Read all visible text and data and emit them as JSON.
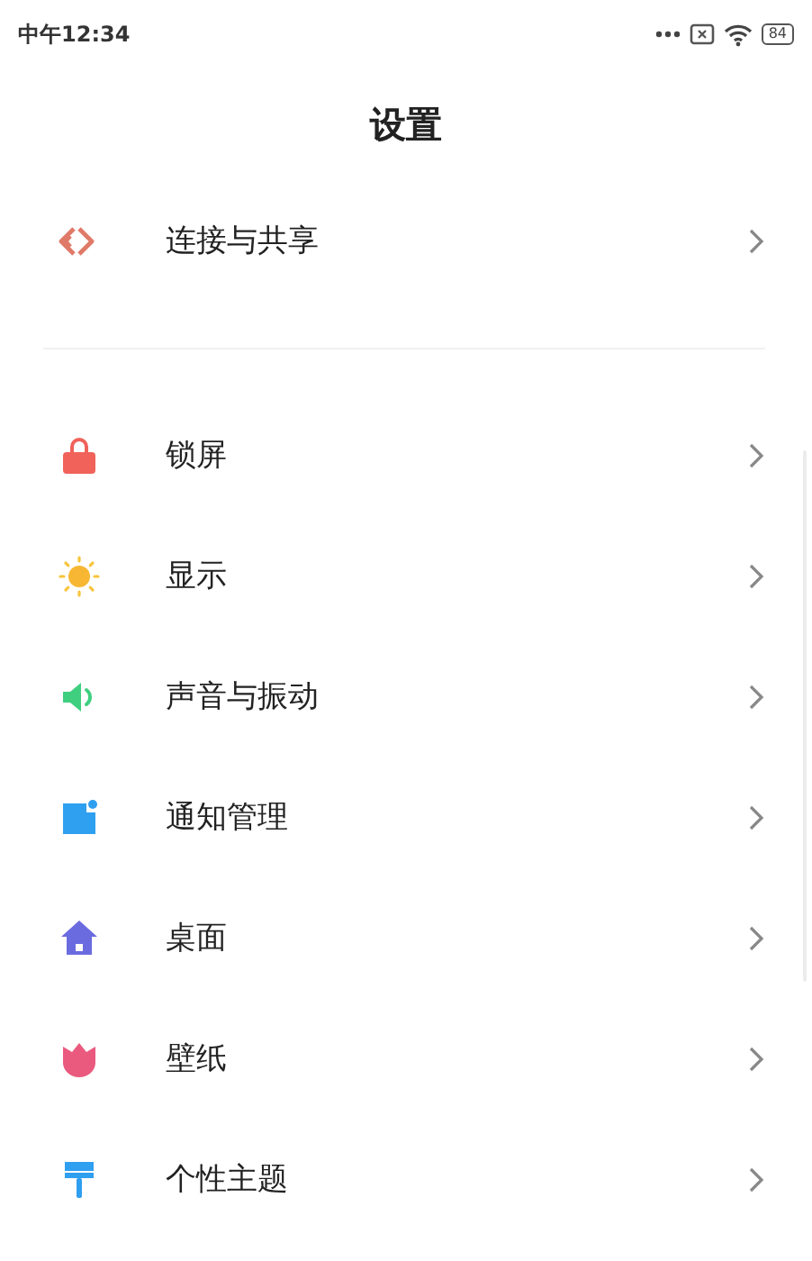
{
  "status_bar": {
    "time": "中午12:34",
    "battery": "84"
  },
  "title": "设置",
  "groups": [
    {
      "items": [
        {
          "label": "连接与共享",
          "kind": "share"
        }
      ]
    },
    {
      "items": [
        {
          "label": "锁屏",
          "kind": "lock"
        },
        {
          "label": "显示",
          "kind": "sun"
        },
        {
          "label": "声音与振动",
          "kind": "sound"
        },
        {
          "label": "通知管理",
          "kind": "notify"
        },
        {
          "label": "桌面",
          "kind": "home"
        },
        {
          "label": "壁纸",
          "kind": "tulip"
        },
        {
          "label": "个性主题",
          "kind": "brush"
        }
      ]
    }
  ]
}
